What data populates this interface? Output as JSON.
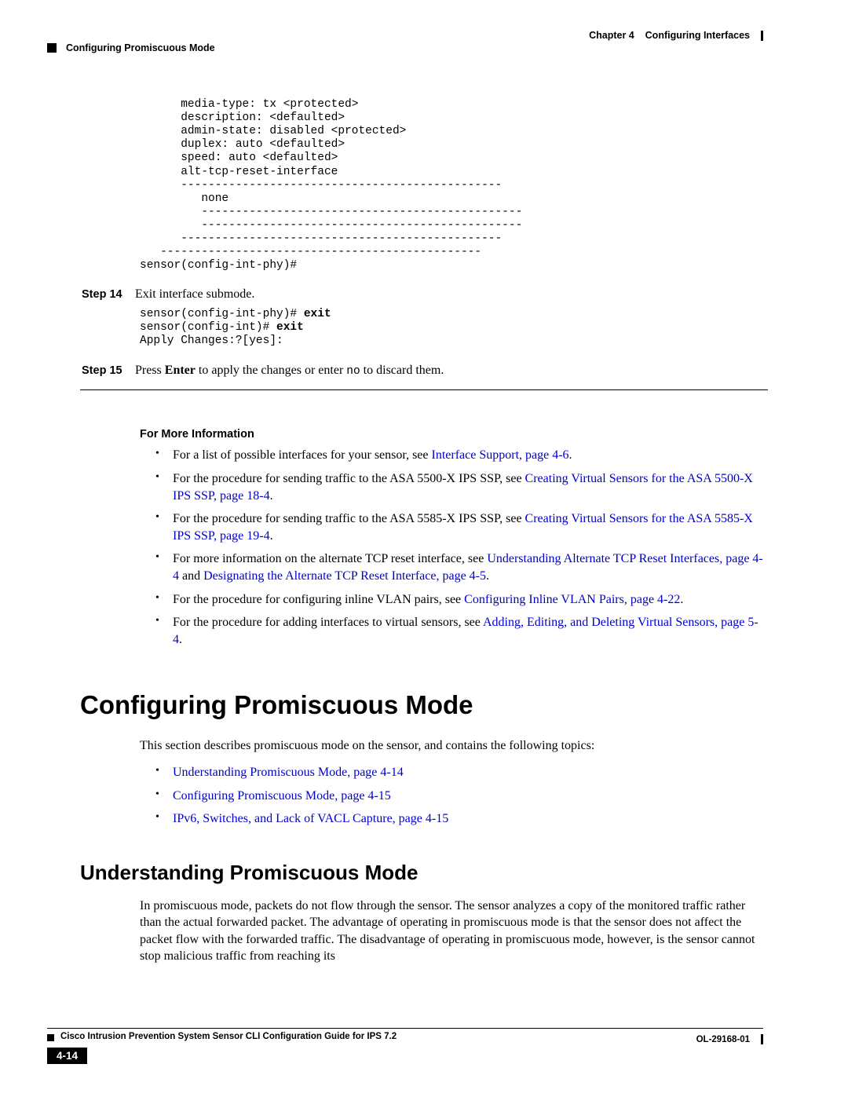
{
  "header": {
    "chapter_label": "Chapter 4",
    "chapter_title": "Configuring Interfaces",
    "section_header_left": "Configuring Promiscuous Mode"
  },
  "pre1": "      media-type: tx <protected>\n      description: <defaulted>\n      admin-state: disabled <protected>\n      duplex: auto <defaulted>\n      speed: auto <defaulted>\n      alt-tcp-reset-interface\n      -----------------------------------------------\n         none\n         -----------------------------------------------\n         -----------------------------------------------\n      -----------------------------------------------\n   -----------------------------------------------\nsensor(config-int-phy)#",
  "step14": {
    "label": "Step 14",
    "text": "Exit interface submode."
  },
  "pre2_prefix1": "sensor(config-int-phy)# ",
  "pre2_cmd1": "exit",
  "pre2_prefix2": "sensor(config-int)# ",
  "pre2_cmd2": "exit",
  "pre2_line3": "Apply Changes:?[yes]:",
  "step15": {
    "label": "Step 15",
    "text_prefix": "Press ",
    "enter": "Enter",
    "text_mid": " to apply the changes or enter ",
    "no": "no",
    "text_suffix": " to discard them."
  },
  "more_info_title": "For More Information",
  "bullets1": [
    {
      "prefix": "For a list of possible interfaces for your sensor, see ",
      "link": "Interface Support, page 4-6",
      "suffix": "."
    },
    {
      "prefix": "For the procedure for sending traffic to the ASA 5500-X IPS SSP, see ",
      "link": "Creating Virtual Sensors for the ASA 5500-X IPS SSP, page 18-4",
      "suffix": "."
    },
    {
      "prefix": "For the procedure for sending traffic to the ASA 5585-X IPS SSP, see ",
      "link": "Creating Virtual Sensors for the ASA 5585-X IPS SSP, page 19-4",
      "suffix": "."
    },
    {
      "prefix": "For more information on the alternate TCP reset interface, see ",
      "link": "Understanding Alternate TCP Reset Interfaces, page 4-4",
      "mid": " and ",
      "link2": "Designating the Alternate TCP Reset Interface, page 4-5",
      "suffix": "."
    },
    {
      "prefix": "For the procedure for configuring inline VLAN pairs, see ",
      "link": "Configuring Inline VLAN Pairs, page 4-22",
      "suffix": "."
    },
    {
      "prefix": "For the procedure for adding interfaces to virtual sensors, see ",
      "link": "Adding, Editing, and Deleting Virtual Sensors, page 5-4",
      "suffix": "."
    }
  ],
  "h1": "Configuring Promiscuous Mode",
  "section_intro": "This section describes promiscuous mode on the sensor, and contains the following topics:",
  "topic_links": [
    "Understanding Promiscuous Mode, page 4-14",
    "Configuring Promiscuous Mode, page 4-15",
    "IPv6, Switches, and Lack of VACL Capture, page 4-15"
  ],
  "h2": "Understanding Promiscuous Mode",
  "para1": "In promiscuous mode, packets do not flow through the sensor. The sensor analyzes a copy of the monitored traffic rather than the actual forwarded packet. The advantage of operating in promiscuous mode is that the sensor does not affect the packet flow with the forwarded traffic. The disadvantage of operating in promiscuous mode, however, is the sensor cannot stop malicious traffic from reaching its",
  "footer": {
    "guide": "Cisco Intrusion Prevention System Sensor CLI Configuration Guide for IPS 7.2",
    "page_num": "4-14",
    "doc_id": "OL-29168-01"
  }
}
